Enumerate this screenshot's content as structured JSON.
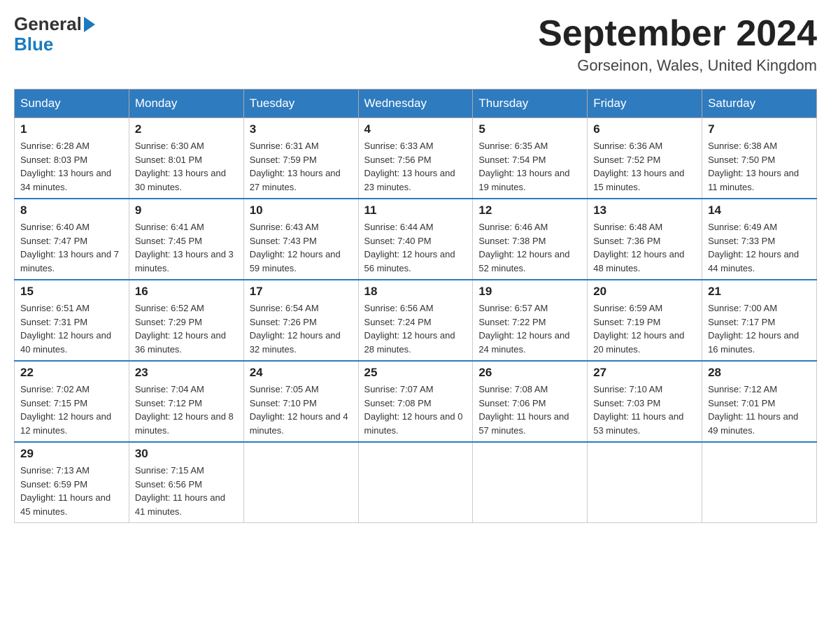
{
  "header": {
    "logo_general": "General",
    "logo_blue": "Blue",
    "title": "September 2024",
    "location": "Gorseinon, Wales, United Kingdom"
  },
  "days_of_week": [
    "Sunday",
    "Monday",
    "Tuesday",
    "Wednesday",
    "Thursday",
    "Friday",
    "Saturday"
  ],
  "weeks": [
    [
      {
        "day": "1",
        "sunrise": "Sunrise: 6:28 AM",
        "sunset": "Sunset: 8:03 PM",
        "daylight": "Daylight: 13 hours and 34 minutes."
      },
      {
        "day": "2",
        "sunrise": "Sunrise: 6:30 AM",
        "sunset": "Sunset: 8:01 PM",
        "daylight": "Daylight: 13 hours and 30 minutes."
      },
      {
        "day": "3",
        "sunrise": "Sunrise: 6:31 AM",
        "sunset": "Sunset: 7:59 PM",
        "daylight": "Daylight: 13 hours and 27 minutes."
      },
      {
        "day": "4",
        "sunrise": "Sunrise: 6:33 AM",
        "sunset": "Sunset: 7:56 PM",
        "daylight": "Daylight: 13 hours and 23 minutes."
      },
      {
        "day": "5",
        "sunrise": "Sunrise: 6:35 AM",
        "sunset": "Sunset: 7:54 PM",
        "daylight": "Daylight: 13 hours and 19 minutes."
      },
      {
        "day": "6",
        "sunrise": "Sunrise: 6:36 AM",
        "sunset": "Sunset: 7:52 PM",
        "daylight": "Daylight: 13 hours and 15 minutes."
      },
      {
        "day": "7",
        "sunrise": "Sunrise: 6:38 AM",
        "sunset": "Sunset: 7:50 PM",
        "daylight": "Daylight: 13 hours and 11 minutes."
      }
    ],
    [
      {
        "day": "8",
        "sunrise": "Sunrise: 6:40 AM",
        "sunset": "Sunset: 7:47 PM",
        "daylight": "Daylight: 13 hours and 7 minutes."
      },
      {
        "day": "9",
        "sunrise": "Sunrise: 6:41 AM",
        "sunset": "Sunset: 7:45 PM",
        "daylight": "Daylight: 13 hours and 3 minutes."
      },
      {
        "day": "10",
        "sunrise": "Sunrise: 6:43 AM",
        "sunset": "Sunset: 7:43 PM",
        "daylight": "Daylight: 12 hours and 59 minutes."
      },
      {
        "day": "11",
        "sunrise": "Sunrise: 6:44 AM",
        "sunset": "Sunset: 7:40 PM",
        "daylight": "Daylight: 12 hours and 56 minutes."
      },
      {
        "day": "12",
        "sunrise": "Sunrise: 6:46 AM",
        "sunset": "Sunset: 7:38 PM",
        "daylight": "Daylight: 12 hours and 52 minutes."
      },
      {
        "day": "13",
        "sunrise": "Sunrise: 6:48 AM",
        "sunset": "Sunset: 7:36 PM",
        "daylight": "Daylight: 12 hours and 48 minutes."
      },
      {
        "day": "14",
        "sunrise": "Sunrise: 6:49 AM",
        "sunset": "Sunset: 7:33 PM",
        "daylight": "Daylight: 12 hours and 44 minutes."
      }
    ],
    [
      {
        "day": "15",
        "sunrise": "Sunrise: 6:51 AM",
        "sunset": "Sunset: 7:31 PM",
        "daylight": "Daylight: 12 hours and 40 minutes."
      },
      {
        "day": "16",
        "sunrise": "Sunrise: 6:52 AM",
        "sunset": "Sunset: 7:29 PM",
        "daylight": "Daylight: 12 hours and 36 minutes."
      },
      {
        "day": "17",
        "sunrise": "Sunrise: 6:54 AM",
        "sunset": "Sunset: 7:26 PM",
        "daylight": "Daylight: 12 hours and 32 minutes."
      },
      {
        "day": "18",
        "sunrise": "Sunrise: 6:56 AM",
        "sunset": "Sunset: 7:24 PM",
        "daylight": "Daylight: 12 hours and 28 minutes."
      },
      {
        "day": "19",
        "sunrise": "Sunrise: 6:57 AM",
        "sunset": "Sunset: 7:22 PM",
        "daylight": "Daylight: 12 hours and 24 minutes."
      },
      {
        "day": "20",
        "sunrise": "Sunrise: 6:59 AM",
        "sunset": "Sunset: 7:19 PM",
        "daylight": "Daylight: 12 hours and 20 minutes."
      },
      {
        "day": "21",
        "sunrise": "Sunrise: 7:00 AM",
        "sunset": "Sunset: 7:17 PM",
        "daylight": "Daylight: 12 hours and 16 minutes."
      }
    ],
    [
      {
        "day": "22",
        "sunrise": "Sunrise: 7:02 AM",
        "sunset": "Sunset: 7:15 PM",
        "daylight": "Daylight: 12 hours and 12 minutes."
      },
      {
        "day": "23",
        "sunrise": "Sunrise: 7:04 AM",
        "sunset": "Sunset: 7:12 PM",
        "daylight": "Daylight: 12 hours and 8 minutes."
      },
      {
        "day": "24",
        "sunrise": "Sunrise: 7:05 AM",
        "sunset": "Sunset: 7:10 PM",
        "daylight": "Daylight: 12 hours and 4 minutes."
      },
      {
        "day": "25",
        "sunrise": "Sunrise: 7:07 AM",
        "sunset": "Sunset: 7:08 PM",
        "daylight": "Daylight: 12 hours and 0 minutes."
      },
      {
        "day": "26",
        "sunrise": "Sunrise: 7:08 AM",
        "sunset": "Sunset: 7:06 PM",
        "daylight": "Daylight: 11 hours and 57 minutes."
      },
      {
        "day": "27",
        "sunrise": "Sunrise: 7:10 AM",
        "sunset": "Sunset: 7:03 PM",
        "daylight": "Daylight: 11 hours and 53 minutes."
      },
      {
        "day": "28",
        "sunrise": "Sunrise: 7:12 AM",
        "sunset": "Sunset: 7:01 PM",
        "daylight": "Daylight: 11 hours and 49 minutes."
      }
    ],
    [
      {
        "day": "29",
        "sunrise": "Sunrise: 7:13 AM",
        "sunset": "Sunset: 6:59 PM",
        "daylight": "Daylight: 11 hours and 45 minutes."
      },
      {
        "day": "30",
        "sunrise": "Sunrise: 7:15 AM",
        "sunset": "Sunset: 6:56 PM",
        "daylight": "Daylight: 11 hours and 41 minutes."
      },
      null,
      null,
      null,
      null,
      null
    ]
  ]
}
